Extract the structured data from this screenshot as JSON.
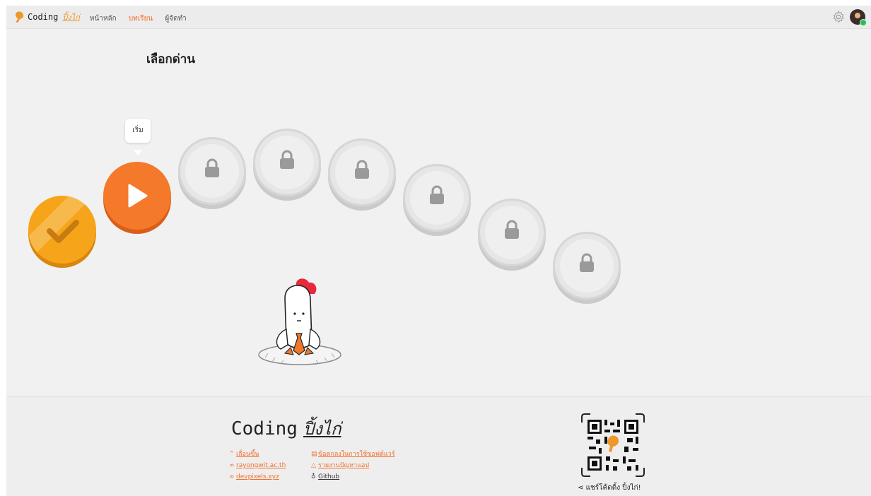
{
  "nav": {
    "logo_name": "Coding",
    "logo_sub": "ปิ้งไก่",
    "links": [
      "หน้าหลัก",
      "บทเรียน",
      "ผู้จัดทำ"
    ]
  },
  "page": {
    "title": "เลือกด่าน"
  },
  "levels": {
    "tooltip": "เริ่ม",
    "states": [
      "completed",
      "current",
      "locked",
      "locked",
      "locked",
      "locked",
      "locked",
      "locked"
    ]
  },
  "footer": {
    "logo_a": "Coding",
    "logo_b": "ปิ้งไก่",
    "links_left": [
      "เลื่อนขึ้น",
      "rayongwit.ac.th",
      "devpixels.xyz"
    ],
    "links_right": [
      "ข้อตกลงในการใช้ซอฟต์แวร์",
      "รายงานปัญหาแอป",
      "Github"
    ],
    "share": "แชร์โค้ดดิ้ง ปิ้งไก่!"
  },
  "colors": {
    "accent": "#f36f2a",
    "gold": "#f6a51a",
    "lock_gray": "#e6e6e6"
  }
}
